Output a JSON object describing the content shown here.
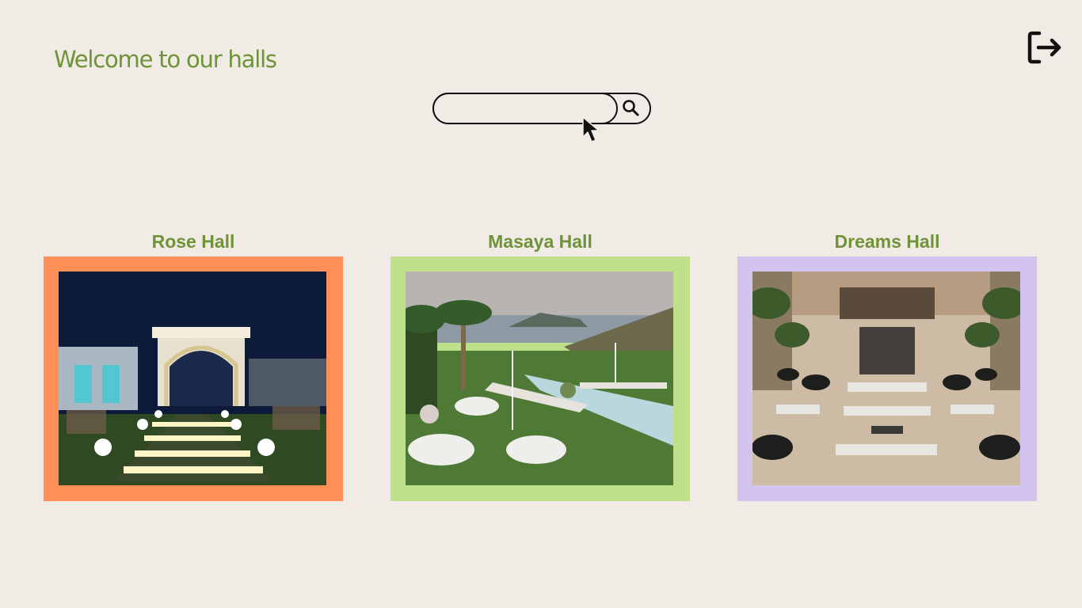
{
  "header": {
    "welcome_text": "Welcome to our halls",
    "logout_icon": "logout-icon"
  },
  "search": {
    "placeholder": "",
    "value": "",
    "button_icon": "search-icon"
  },
  "halls": [
    {
      "name": "Rose Hall",
      "frame_color": "#ff8f56",
      "photo": "night-venue-with-lit-pathway"
    },
    {
      "name": "Masaya Hall",
      "frame_color": "#bfe08a",
      "photo": "garden-venue-with-pool-and-tables"
    },
    {
      "name": "Dreams Hall",
      "frame_color": "#d2c3ef",
      "photo": "courtyard-venue-with-banquet-tables"
    }
  ],
  "colors": {
    "background": "#f0ebe5",
    "accent_green": "#6f9437",
    "rose_frame": "#ff8f56",
    "masaya_frame": "#bfe08a",
    "dreams_frame": "#d2c3ef"
  }
}
